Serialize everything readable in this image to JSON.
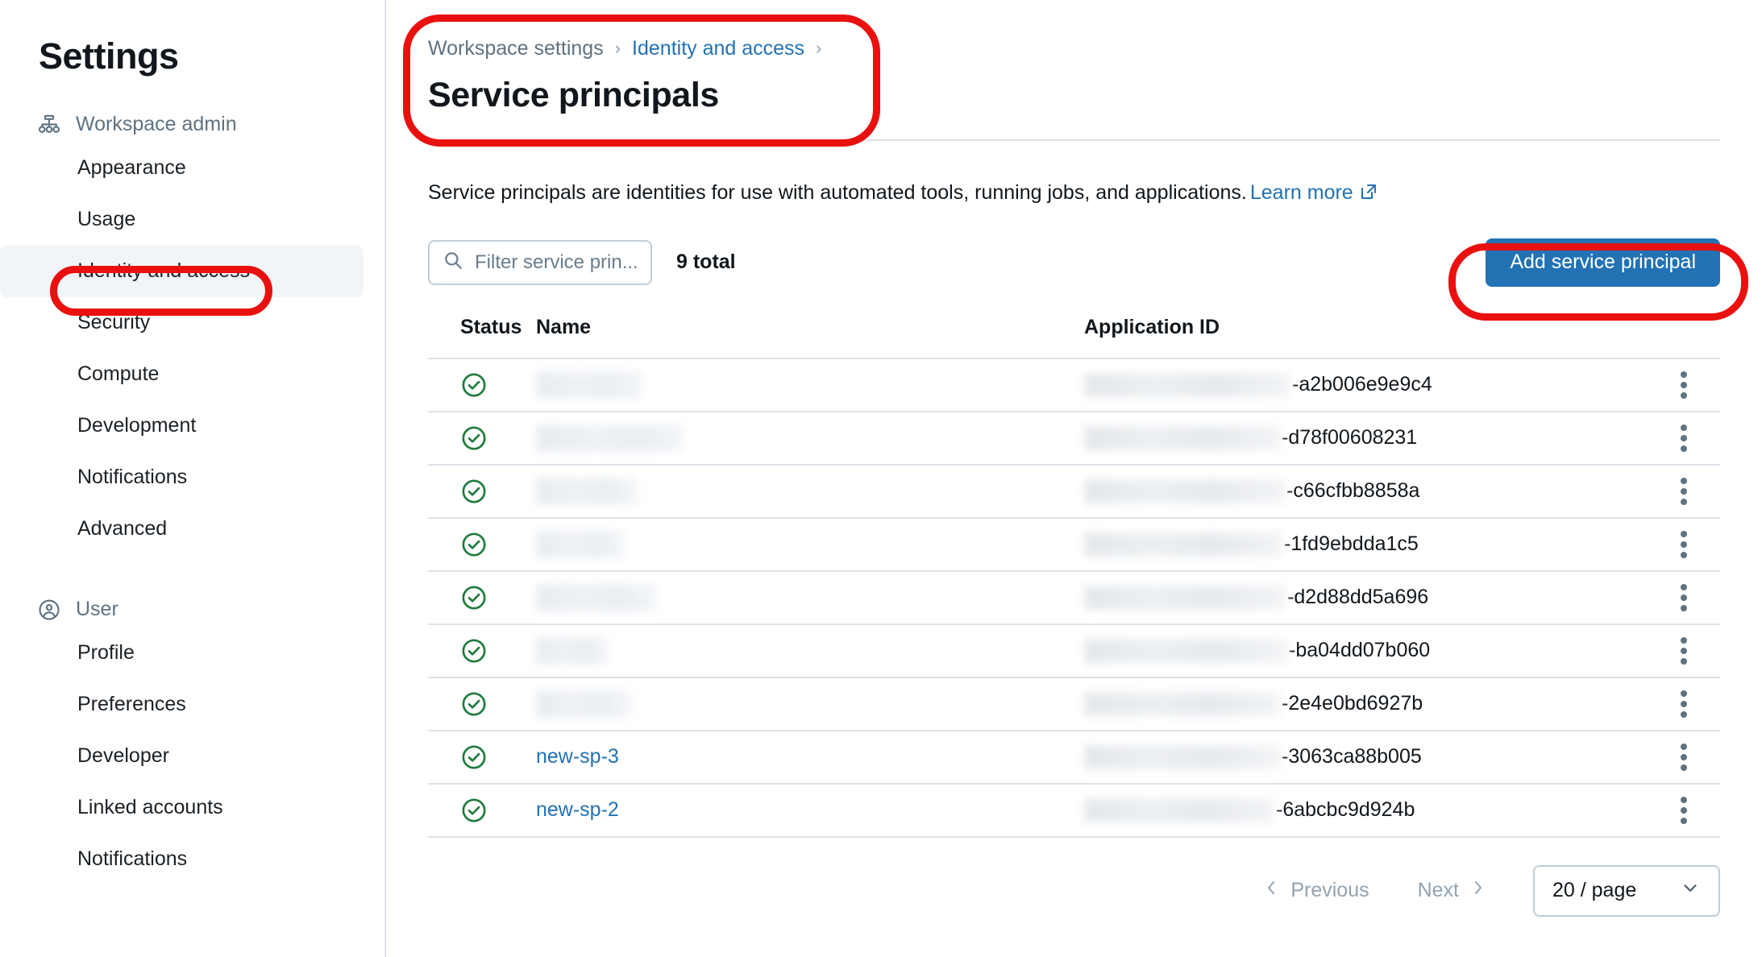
{
  "sidebar": {
    "title": "Settings",
    "groups": [
      {
        "label": "Workspace admin",
        "icon": "hierarchy-icon",
        "items": [
          {
            "label": "Appearance",
            "selected": false
          },
          {
            "label": "Usage",
            "selected": false
          },
          {
            "label": "Identity and access",
            "selected": true
          },
          {
            "label": "Security",
            "selected": false
          },
          {
            "label": "Compute",
            "selected": false
          },
          {
            "label": "Development",
            "selected": false
          },
          {
            "label": "Notifications",
            "selected": false
          },
          {
            "label": "Advanced",
            "selected": false
          }
        ]
      },
      {
        "label": "User",
        "icon": "user-circle-icon",
        "items": [
          {
            "label": "Profile",
            "selected": false
          },
          {
            "label": "Preferences",
            "selected": false
          },
          {
            "label": "Developer",
            "selected": false
          },
          {
            "label": "Linked accounts",
            "selected": false
          },
          {
            "label": "Notifications",
            "selected": false
          }
        ]
      }
    ]
  },
  "header": {
    "breadcrumb": [
      {
        "label": "Workspace settings",
        "is_link": false
      },
      {
        "label": "Identity and access",
        "is_link": true
      }
    ],
    "separator": "›",
    "title": "Service principals"
  },
  "description": {
    "text": "Service principals are identities for use with automated tools, running jobs, and applications.",
    "learn_more": "Learn more",
    "learn_more_icon": "external-link-icon"
  },
  "toolbar": {
    "filter_placeholder": "Filter service prin...",
    "filter_value": "",
    "search_icon": "search-icon",
    "total_label": "9 total",
    "add_button": "Add service principal"
  },
  "table": {
    "columns": [
      "Status",
      "Name",
      "Application ID"
    ],
    "rows": [
      {
        "status_icon": "check-circle-icon",
        "name": "",
        "name_blurred": true,
        "name_blur_width": 132,
        "app_id_suffix": "-a2b006e9e9c4",
        "app_id_blur_width": 256,
        "menu_icon": "kebab-menu-icon"
      },
      {
        "status_icon": "check-circle-icon",
        "name": "",
        "name_blurred": true,
        "name_blur_width": 184,
        "app_id_suffix": "-d78f00608231",
        "app_id_blur_width": 243,
        "menu_icon": "kebab-menu-icon"
      },
      {
        "status_icon": "check-circle-icon",
        "name": "",
        "name_blurred": true,
        "name_blur_width": 126,
        "app_id_suffix": "-c66cfbb8858a",
        "app_id_blur_width": 249,
        "menu_icon": "kebab-menu-icon"
      },
      {
        "status_icon": "check-circle-icon",
        "name": "",
        "name_blurred": true,
        "name_blur_width": 110,
        "app_id_suffix": "-1fd9ebdda1c5",
        "app_id_blur_width": 246,
        "menu_icon": "kebab-menu-icon"
      },
      {
        "status_icon": "check-circle-icon",
        "name": "",
        "name_blurred": true,
        "name_blur_width": 150,
        "app_id_suffix": "-d2d88dd5a696",
        "app_id_blur_width": 250,
        "menu_icon": "kebab-menu-icon"
      },
      {
        "status_icon": "check-circle-icon",
        "name": "",
        "name_blurred": true,
        "name_blur_width": 90,
        "app_id_suffix": "-ba04dd07b060",
        "app_id_blur_width": 252,
        "menu_icon": "kebab-menu-icon"
      },
      {
        "status_icon": "check-circle-icon",
        "name": "",
        "name_blurred": true,
        "name_blur_width": 118,
        "app_id_suffix": "-2e4e0bd6927b",
        "app_id_blur_width": 243,
        "menu_icon": "kebab-menu-icon"
      },
      {
        "status_icon": "check-circle-icon",
        "name": "new-sp-3",
        "name_blurred": false,
        "name_blur_width": 0,
        "app_id_suffix": "-3063ca88b005",
        "app_id_blur_width": 243,
        "menu_icon": "kebab-menu-icon"
      },
      {
        "status_icon": "check-circle-icon",
        "name": "new-sp-2",
        "name_blurred": false,
        "name_blur_width": 0,
        "app_id_suffix": "-6abcbc9d924b",
        "app_id_blur_width": 236,
        "menu_icon": "kebab-menu-icon"
      }
    ]
  },
  "pagination": {
    "previous": "Previous",
    "next": "Next",
    "prev_icon": "chevron-left-icon",
    "next_icon": "chevron-right-icon",
    "page_size": "20 / page",
    "page_size_icon": "chevron-down-icon"
  },
  "annotations": [
    {
      "name": "annotation-sidebar-identity-and-access",
      "shape": "rounded-rect",
      "color": "#e8110f"
    },
    {
      "name": "annotation-page-title",
      "shape": "rounded-rect",
      "color": "#e8110f"
    },
    {
      "name": "annotation-add-service-principal",
      "shape": "rounded-rect",
      "color": "#e8110f"
    }
  ],
  "colors": {
    "accent_blue": "#2272b4",
    "link_blue": "#2272b4",
    "status_green": "#1e7b3c",
    "annotation_red": "#e8110f",
    "border": "#dde3ea",
    "selected_bg": "#f2f5f7",
    "muted_text": "#5f7281"
  }
}
